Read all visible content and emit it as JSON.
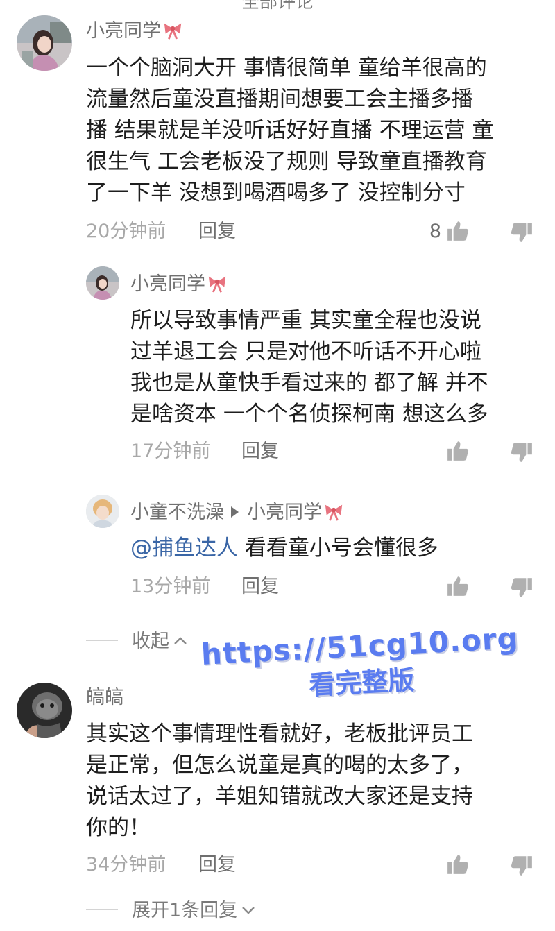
{
  "top_cut_text": "全部评论",
  "comments": [
    {
      "username": "小亮同学",
      "text_lines": [
        "一个个脑洞大开 事情很简单 童给羊很高的",
        "流量然后童没直播期间想要工会主播多播",
        "播 结果就是羊没听话好好直播 不理运营 童",
        "很生气 工会老板没了规则 导致童直播教育",
        "了一下羊 没想到喝酒喝多了 没控制分寸"
      ],
      "time": "20分钟前",
      "reply_label": "回复",
      "likes": "8",
      "replies": [
        {
          "username": "小亮同学",
          "text_lines": [
            "所以导致事情严重 其实童全程也没说",
            "过羊退工会 只是对他不听话不开心啦",
            "我也是从童快手看过来的 都了解 并不",
            "是啥资本 一个个名侦探柯南 想这么多"
          ],
          "time": "17分钟前",
          "reply_label": "回复"
        },
        {
          "username": "小童不洗澡",
          "reply_to": "小亮同学",
          "mention": "@捕鱼达人",
          "text": " 看看童小号会懂很多",
          "time": "13分钟前",
          "reply_label": "回复"
        }
      ],
      "collapse_label": "收起"
    },
    {
      "username": "皜皜",
      "text_lines": [
        "其实这个事情理性看就好，老板批评员工",
        "是正常，但怎么说童是真的喝的太多了，",
        "说话太过了，羊姐知错就改大家还是支持",
        "你的！"
      ],
      "time": "34分钟前",
      "reply_label": "回复",
      "expand_label": "展开1条回复"
    }
  ],
  "watermark": {
    "url": "https://51cg10.org",
    "subtitle": "看完整版"
  },
  "colors": {
    "username": "#707070",
    "body": "#1e1e1e",
    "meta": "#a8a8a8",
    "mention": "#3a66a6",
    "watermark": "#5a7cf0",
    "bow": "#e8737f"
  },
  "icons": {
    "like": "thumbs-up-icon",
    "dislike": "thumbs-down-icon",
    "bow": "ribbon-bow-icon",
    "collapse": "chevron-up-icon",
    "expand": "chevron-down-icon"
  }
}
